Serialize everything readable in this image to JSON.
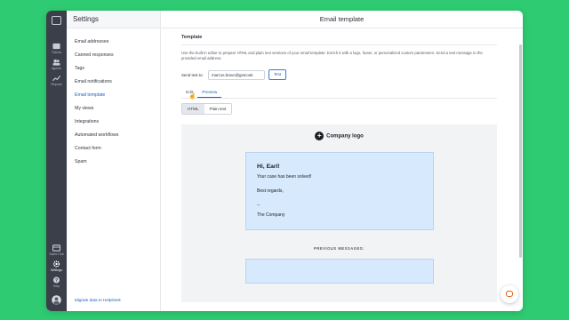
{
  "rail": {
    "items": [
      {
        "label": "Tickets",
        "icon": "inbox-icon"
      },
      {
        "label": "Agents",
        "icon": "users-icon"
      },
      {
        "label": "Reports",
        "icon": "chart-icon"
      }
    ],
    "bottom": [
      {
        "label": "Sales Hub",
        "icon": "store-icon"
      },
      {
        "label": "Settings",
        "icon": "gear-icon"
      },
      {
        "label": "Help",
        "icon": "question-icon"
      }
    ]
  },
  "sidebar": {
    "title": "Settings",
    "items": [
      {
        "label": "Email addresses"
      },
      {
        "label": "Canned responses"
      },
      {
        "label": "Tags"
      },
      {
        "label": "Email notifications"
      },
      {
        "label": "Email template"
      },
      {
        "label": "My views"
      },
      {
        "label": "Integrations"
      },
      {
        "label": "Automated workflows"
      },
      {
        "label": "Contact form"
      },
      {
        "label": "Spam"
      }
    ],
    "active_index": 4,
    "footer_link": "Migrate data to HelpDesk"
  },
  "main": {
    "title": "Email template",
    "section_title": "Template",
    "description": "Use the built-in editor to prepare HTML and plain text versions of your email template. Enrich it with a logo, footer, or personalized custom parameters. Send a test message to the provided email address.",
    "send_test": {
      "label": "Send test to:",
      "value": "marcos.bravo@getcook",
      "button": "Test"
    },
    "tabs": [
      {
        "label": "Edit"
      },
      {
        "label": "Preview"
      }
    ],
    "active_tab": 1,
    "format_toggle": [
      {
        "label": "HTML"
      },
      {
        "label": "Plain text"
      }
    ],
    "active_format": 0,
    "preview": {
      "logo_text": "Company logo",
      "greeting": "Hi, Earl!",
      "line1": "Your case has been solved!",
      "line2": "Best regards,",
      "line3": "--",
      "line4": "The Company",
      "previous_label": "PREVIOUS MESSAGES:"
    }
  },
  "colors": {
    "background": "#2ecb72",
    "rail": "#3b3f4a",
    "accent": "#1f5fbf",
    "email_card": "#d6e9fd",
    "chat_accent": "#e8590c"
  }
}
